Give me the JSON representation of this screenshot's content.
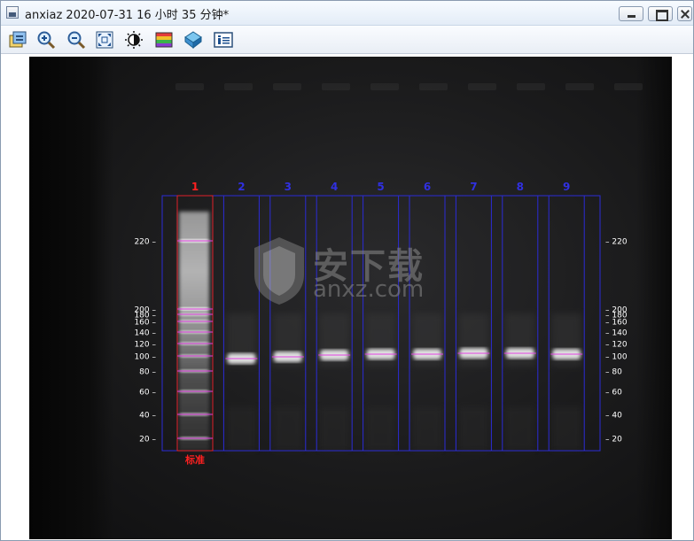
{
  "window": {
    "title": "anxiaz 2020-07-31 16 小时 35 分钟*"
  },
  "toolbar": {
    "tools": [
      {
        "name": "image-select-tool-icon",
        "label": ""
      },
      {
        "name": "zoom-in-icon",
        "label": ""
      },
      {
        "name": "zoom-out-icon",
        "label": ""
      },
      {
        "name": "fit-to-window-icon",
        "label": ""
      },
      {
        "name": "brightness-contrast-icon",
        "label": ""
      },
      {
        "name": "color-palette-icon",
        "label": ""
      },
      {
        "name": "cube-3d-icon",
        "label": ""
      },
      {
        "name": "info-icon",
        "label": ""
      }
    ]
  },
  "gel": {
    "lanes": [
      "1",
      "2",
      "3",
      "4",
      "5",
      "6",
      "7",
      "8",
      "9"
    ],
    "standard_label": "标准",
    "left_scale": [
      "220",
      "200",
      "180",
      "160",
      "140",
      "120",
      "100",
      "80",
      "60",
      "40",
      "20"
    ],
    "right_scale": [
      "220",
      "200",
      "180",
      "160",
      "140",
      "120",
      "100",
      "80",
      "60",
      "40",
      "20"
    ],
    "colors": {
      "lane_box": "#2b2bd6",
      "standard_box": "#e0202a",
      "band_marker": "#e040e0",
      "lane_label": "#3030e0",
      "standard_label": "#ff2020",
      "scale_text": "#ffffff"
    }
  },
  "watermark": {
    "main": "安下载",
    "sub": "anxz.com"
  }
}
